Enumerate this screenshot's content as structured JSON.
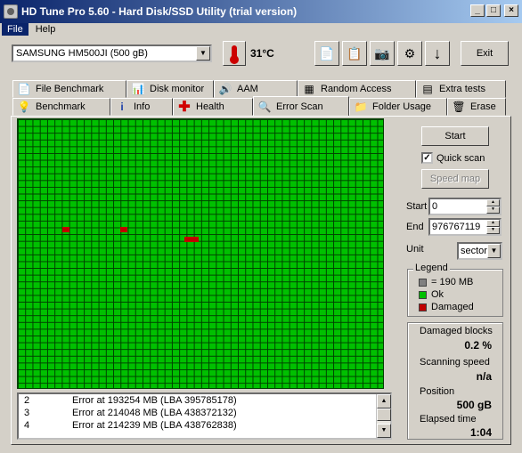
{
  "window": {
    "title": "HD Tune Pro 5.60 - Hard Disk/SSD Utility (trial version)"
  },
  "menu": {
    "file": "File",
    "help": "Help"
  },
  "toolbar": {
    "drive": "SAMSUNG HM500JI (500 gB)",
    "temperature": "31°C",
    "exit_label": "Exit"
  },
  "tabs_top": [
    {
      "label": "File Benchmark",
      "icon": "file-benchmark-icon"
    },
    {
      "label": "Disk monitor",
      "icon": "disk-monitor-icon"
    },
    {
      "label": "AAM",
      "icon": "speaker-icon"
    },
    {
      "label": "Random Access",
      "icon": "random-access-icon"
    },
    {
      "label": "Extra tests",
      "icon": "extra-tests-icon"
    }
  ],
  "tabs_bottom": [
    {
      "label": "Benchmark",
      "icon": "lightbulb-icon"
    },
    {
      "label": "Info",
      "icon": "info-icon"
    },
    {
      "label": "Health",
      "icon": "health-cross-icon"
    },
    {
      "label": "Error Scan",
      "icon": "magnifier-icon",
      "active": true
    },
    {
      "label": "Folder Usage",
      "icon": "folder-icon"
    },
    {
      "label": "Erase",
      "icon": "trash-icon"
    }
  ],
  "scan": {
    "start_button": "Start",
    "quick_scan_label": "Quick scan",
    "quick_scan_checked": true,
    "speed_map_button": "Speed map",
    "start_label": "Start",
    "start_value": "0",
    "end_label": "End",
    "end_value": "976767119",
    "unit_label": "Unit",
    "unit_value": "sector"
  },
  "legend": {
    "title": "Legend",
    "block_size": "= 190 MB",
    "ok": "Ok",
    "damaged": "Damaged",
    "colors": {
      "block": "#808080",
      "ok": "#00c000",
      "damaged": "#c00000"
    }
  },
  "stats": {
    "damaged_blocks_label": "Damaged blocks",
    "damaged_blocks_value": "0.2 %",
    "scanning_speed_label": "Scanning speed",
    "scanning_speed_value": "n/a",
    "position_label": "Position",
    "position_value": "500 gB",
    "elapsed_label": "Elapsed time",
    "elapsed_value": "1:04"
  },
  "log": [
    {
      "num": "2",
      "text": "Error at 193254 MB (LBA 395785178)"
    },
    {
      "num": "3",
      "text": "Error at 214048 MB (LBA 438372132)"
    },
    {
      "num": "4",
      "text": "Error at 214239 MB (LBA 438762838)"
    }
  ]
}
